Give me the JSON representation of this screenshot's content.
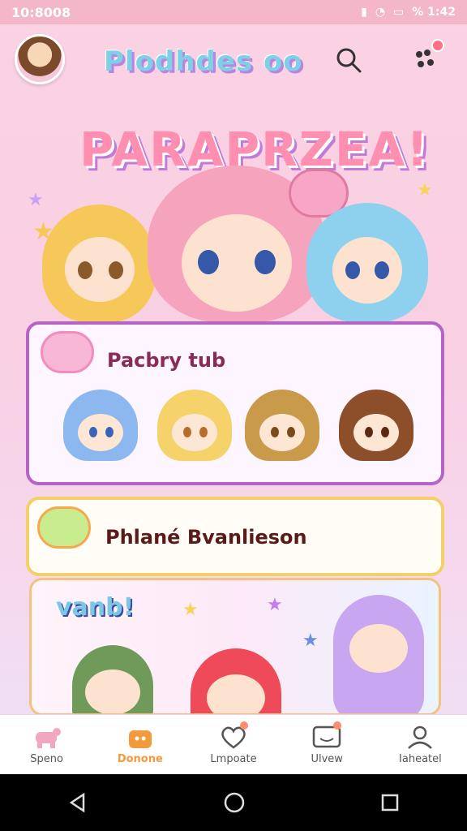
{
  "status_bar": {
    "left_text": "10:8008",
    "right_text": "% 1:42"
  },
  "app": {
    "title": "Plodhdes oo"
  },
  "hero": {
    "title": "PARAPRZEA!"
  },
  "cards": {
    "party": {
      "title": "Pacbry tub"
    },
    "blue": {
      "title": "Phlané Bvanlieson"
    },
    "feature": {
      "badge": "vanb!"
    }
  },
  "bottom_nav": [
    {
      "label": "Speno",
      "icon": "paw-icon"
    },
    {
      "label": "Donone",
      "icon": "bag-icon"
    },
    {
      "label": "Lmpoate",
      "icon": "heart-icon"
    },
    {
      "label": "Ulvew",
      "icon": "message-icon"
    },
    {
      "label": "Iaheatel",
      "icon": "profile-icon"
    }
  ],
  "colors": {
    "accent": "#f39a3d",
    "pink": "#ff8fb0",
    "purple": "#b663c5"
  }
}
